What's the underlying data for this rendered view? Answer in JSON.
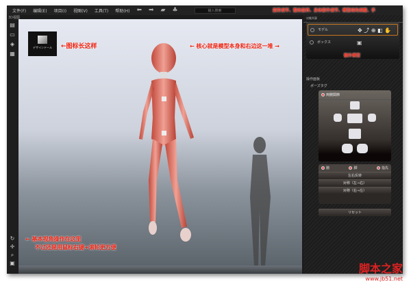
{
  "menu": {
    "items": [
      "文件(F)",
      "编辑(E)",
      "项目(I)",
      "视图(V)",
      "工具(T)",
      "帮助(H)"
    ],
    "search_placeholder": "输入搜索"
  },
  "viewport": {
    "label": "3D视图",
    "logo_text": "デザインドール"
  },
  "panel": {
    "object_list_label": "对象列表",
    "objects": [
      "モデル",
      "ボックス"
    ],
    "ops_label": "操作面板",
    "pose_tag": "ポーズタグ",
    "body_group": "両腕関節",
    "radios": [
      "腕",
      "脚",
      "指先"
    ],
    "buttons": [
      "左右反转",
      "对称（左→右）",
      "对称（右→左）"
    ],
    "reset": "リセット"
  },
  "annotations": {
    "icon": "←图标长这样",
    "core": "← 核心就是模型本身和右边这一堆 →",
    "tools": "姿势调节、整体旋转、身体部件调节、模型结构调整、手",
    "extra": "额外模型",
    "view_ops_1": "← 基本视角操作在这里",
    "view_ops_2": "不过还是用鼠标右键+滚轮更方便"
  },
  "watermark": {
    "title": "脚本之家",
    "url": "www.jb51.net"
  }
}
